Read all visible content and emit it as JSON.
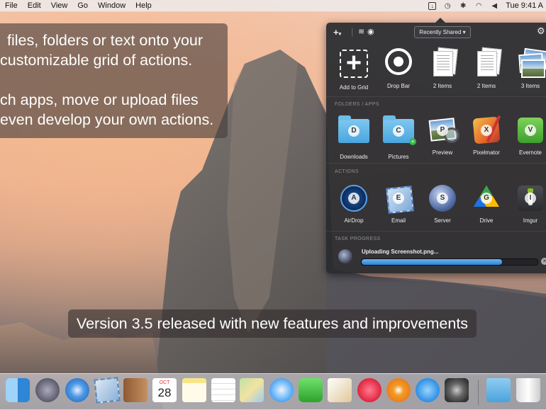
{
  "menubar": {
    "items": [
      "File",
      "Edit",
      "View",
      "Go",
      "Window",
      "Help"
    ],
    "clock": "Tue 9:41 A"
  },
  "promo": {
    "lines": [
      "files, folders or text onto your",
      "customizable grid of actions.",
      "ch apps, move or upload files",
      "even develop your own actions."
    ]
  },
  "panel": {
    "dropdown_label": "Recently Shared",
    "add_label": "+",
    "gear_label": "⚙",
    "recent_items": [
      {
        "label": "Add to Grid",
        "icon": "add-grid-icon"
      },
      {
        "label": "Drop Bar",
        "icon": "drop-bar-icon"
      },
      {
        "label": "2 Items",
        "icon": "documents-icon"
      },
      {
        "label": "2 Items",
        "icon": "documents-icon"
      },
      {
        "label": "3 Items",
        "icon": "photos-icon"
      }
    ],
    "folders_heading": "FOLDERS / APPS",
    "folders": [
      {
        "label": "Downloads",
        "letter": "D",
        "icon": "downloads-folder-icon"
      },
      {
        "label": "Pictures",
        "letter": "C",
        "icon": "pictures-folder-icon"
      },
      {
        "label": "Preview",
        "letter": "P",
        "icon": "preview-app-icon"
      },
      {
        "label": "Pixelmator",
        "letter": "X",
        "icon": "pixelmator-app-icon"
      },
      {
        "label": "Evernote",
        "letter": "V",
        "icon": "evernote-app-icon"
      }
    ],
    "actions_heading": "ACTIONS",
    "actions": [
      {
        "label": "AirDrop",
        "letter": "A",
        "icon": "airdrop-icon"
      },
      {
        "label": "Email",
        "letter": "E",
        "icon": "email-icon"
      },
      {
        "label": "Server",
        "letter": "S",
        "icon": "server-icon"
      },
      {
        "label": "Drive",
        "letter": "G",
        "icon": "drive-icon"
      },
      {
        "label": "Imgur",
        "letter": "I",
        "icon": "imgur-icon"
      }
    ],
    "task_heading": "TASK PROGRESS",
    "task_label": "Uploading Screenshot.png...",
    "task_progress": 0.8
  },
  "caption": "Version 3.5 released with new features and improvements",
  "dock": {
    "calendar_month": "OCT",
    "calendar_day": "28",
    "icons": [
      "finder-icon",
      "launchpad-icon",
      "safari-icon",
      "mail-icon",
      "contacts-icon",
      "calendar-icon",
      "notes-icon",
      "reminders-icon",
      "maps-icon",
      "messages-icon",
      "facetime-icon",
      "pages-icon",
      "itunes-icon",
      "ibooks-icon",
      "app-store-icon",
      "system-preferences-icon",
      "downloads-stack-icon",
      "trash-icon"
    ]
  },
  "colors": {
    "panel_bg": "#2a2c30",
    "progress": "#3a90de",
    "folder": "#5cb3e6"
  }
}
